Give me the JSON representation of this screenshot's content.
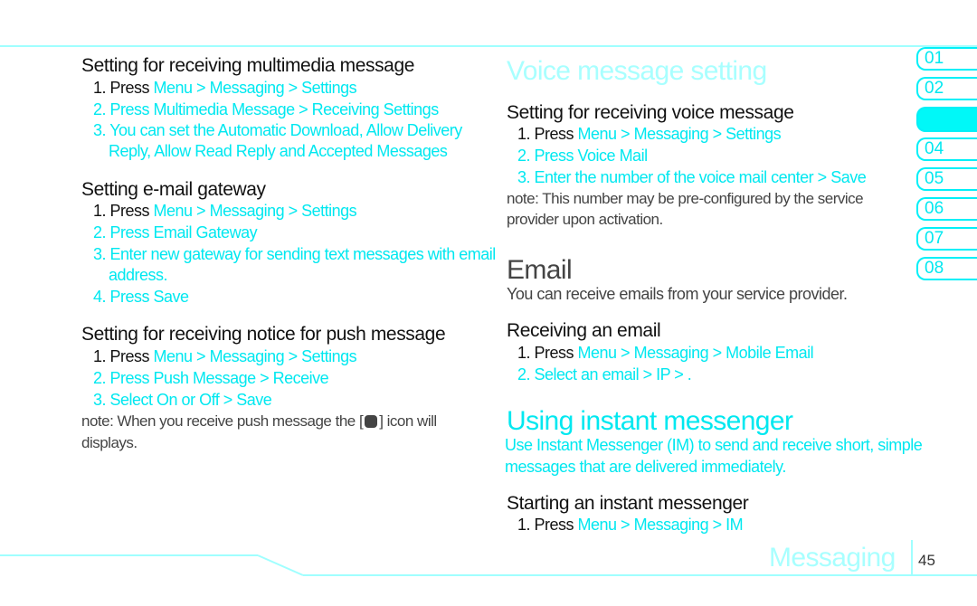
{
  "left": {
    "sections": [
      {
        "heading": "Setting for receiving multimedia message",
        "items": [
          {
            "prefix": "1. Press",
            "text": " Menu > Messaging > Settings"
          },
          {
            "prefix": "2. Press",
            "text": " Multimedia Message > Receiving Settings"
          },
          {
            "prefix": "3. You can set the",
            "text": " Automatic Download, Allow Delivery"
          },
          {
            "prefix": "",
            "text": "Reply, Allow Read Reply and Accepted Messages"
          }
        ]
      },
      {
        "heading": "Setting e-mail gateway",
        "items": [
          {
            "prefix": "1. Press",
            "text": " Menu > Messaging > Settings"
          },
          {
            "prefix": "2. Press",
            "text": " Email Gateway"
          },
          {
            "prefix": "3. Enter new gateway for sending text messages with email",
            "text": ""
          },
          {
            "prefix": "",
            "text": "address."
          },
          {
            "prefix": "4. Press",
            "text": " Save"
          }
        ]
      },
      {
        "heading": "Setting for receiving notice for push message",
        "items": [
          {
            "prefix": "1. Press",
            "text": " Menu > Messaging > Settings"
          },
          {
            "prefix": "2. Press",
            "text": " Push Message > Receive"
          },
          {
            "prefix": "3. Select",
            "text": " On or Off > Save"
          }
        ],
        "note_before_icon": "note:  When you receive push message the [",
        "note_after_icon": "] icon will",
        "note_line2": "displays."
      }
    ]
  },
  "right": {
    "voice_title": "Voice message setting",
    "voice_heading": "Setting for receiving voice message",
    "voice_items": [
      {
        "prefix": "1. Press",
        "text": " Menu > Messaging > Settings"
      },
      {
        "prefix": "2. Press",
        "text": " Voice Mail"
      },
      {
        "prefix": "3. Enter the number of the voice mail center >",
        "text": " Save"
      }
    ],
    "voice_note_1": "note:  This number may be pre-configured by the service",
    "voice_note_2": "provider upon activation.",
    "email_title": "Email",
    "email_body": "You can receive emails from your service provider.",
    "recv_heading": "Receiving an email",
    "recv_items": [
      {
        "prefix": "1. Press",
        "text": " Menu > Messaging > Mobile Email"
      },
      {
        "prefix": "2. Select an email >",
        "text": " IP > ."
      }
    ],
    "im_title": "Using instant messenger",
    "im_body_1": "Use Instant Messenger (IM) to send and receive short, simple",
    "im_body_2": "messages that are delivered immediately.",
    "im_heading": "Starting an instant messenger",
    "im_items": [
      {
        "prefix": "1. Press",
        "text": " Menu > Messaging > IM"
      }
    ]
  },
  "tabs": [
    "01",
    "02",
    "",
    "04",
    "05",
    "06",
    "07",
    "08"
  ],
  "active_tab_index": 2,
  "footer": {
    "section": "Messaging",
    "page": "45"
  },
  "colors": {
    "accent": "#00e8f0",
    "pale_accent": "#a0ffff",
    "text": "#111111",
    "note": "#444444"
  }
}
